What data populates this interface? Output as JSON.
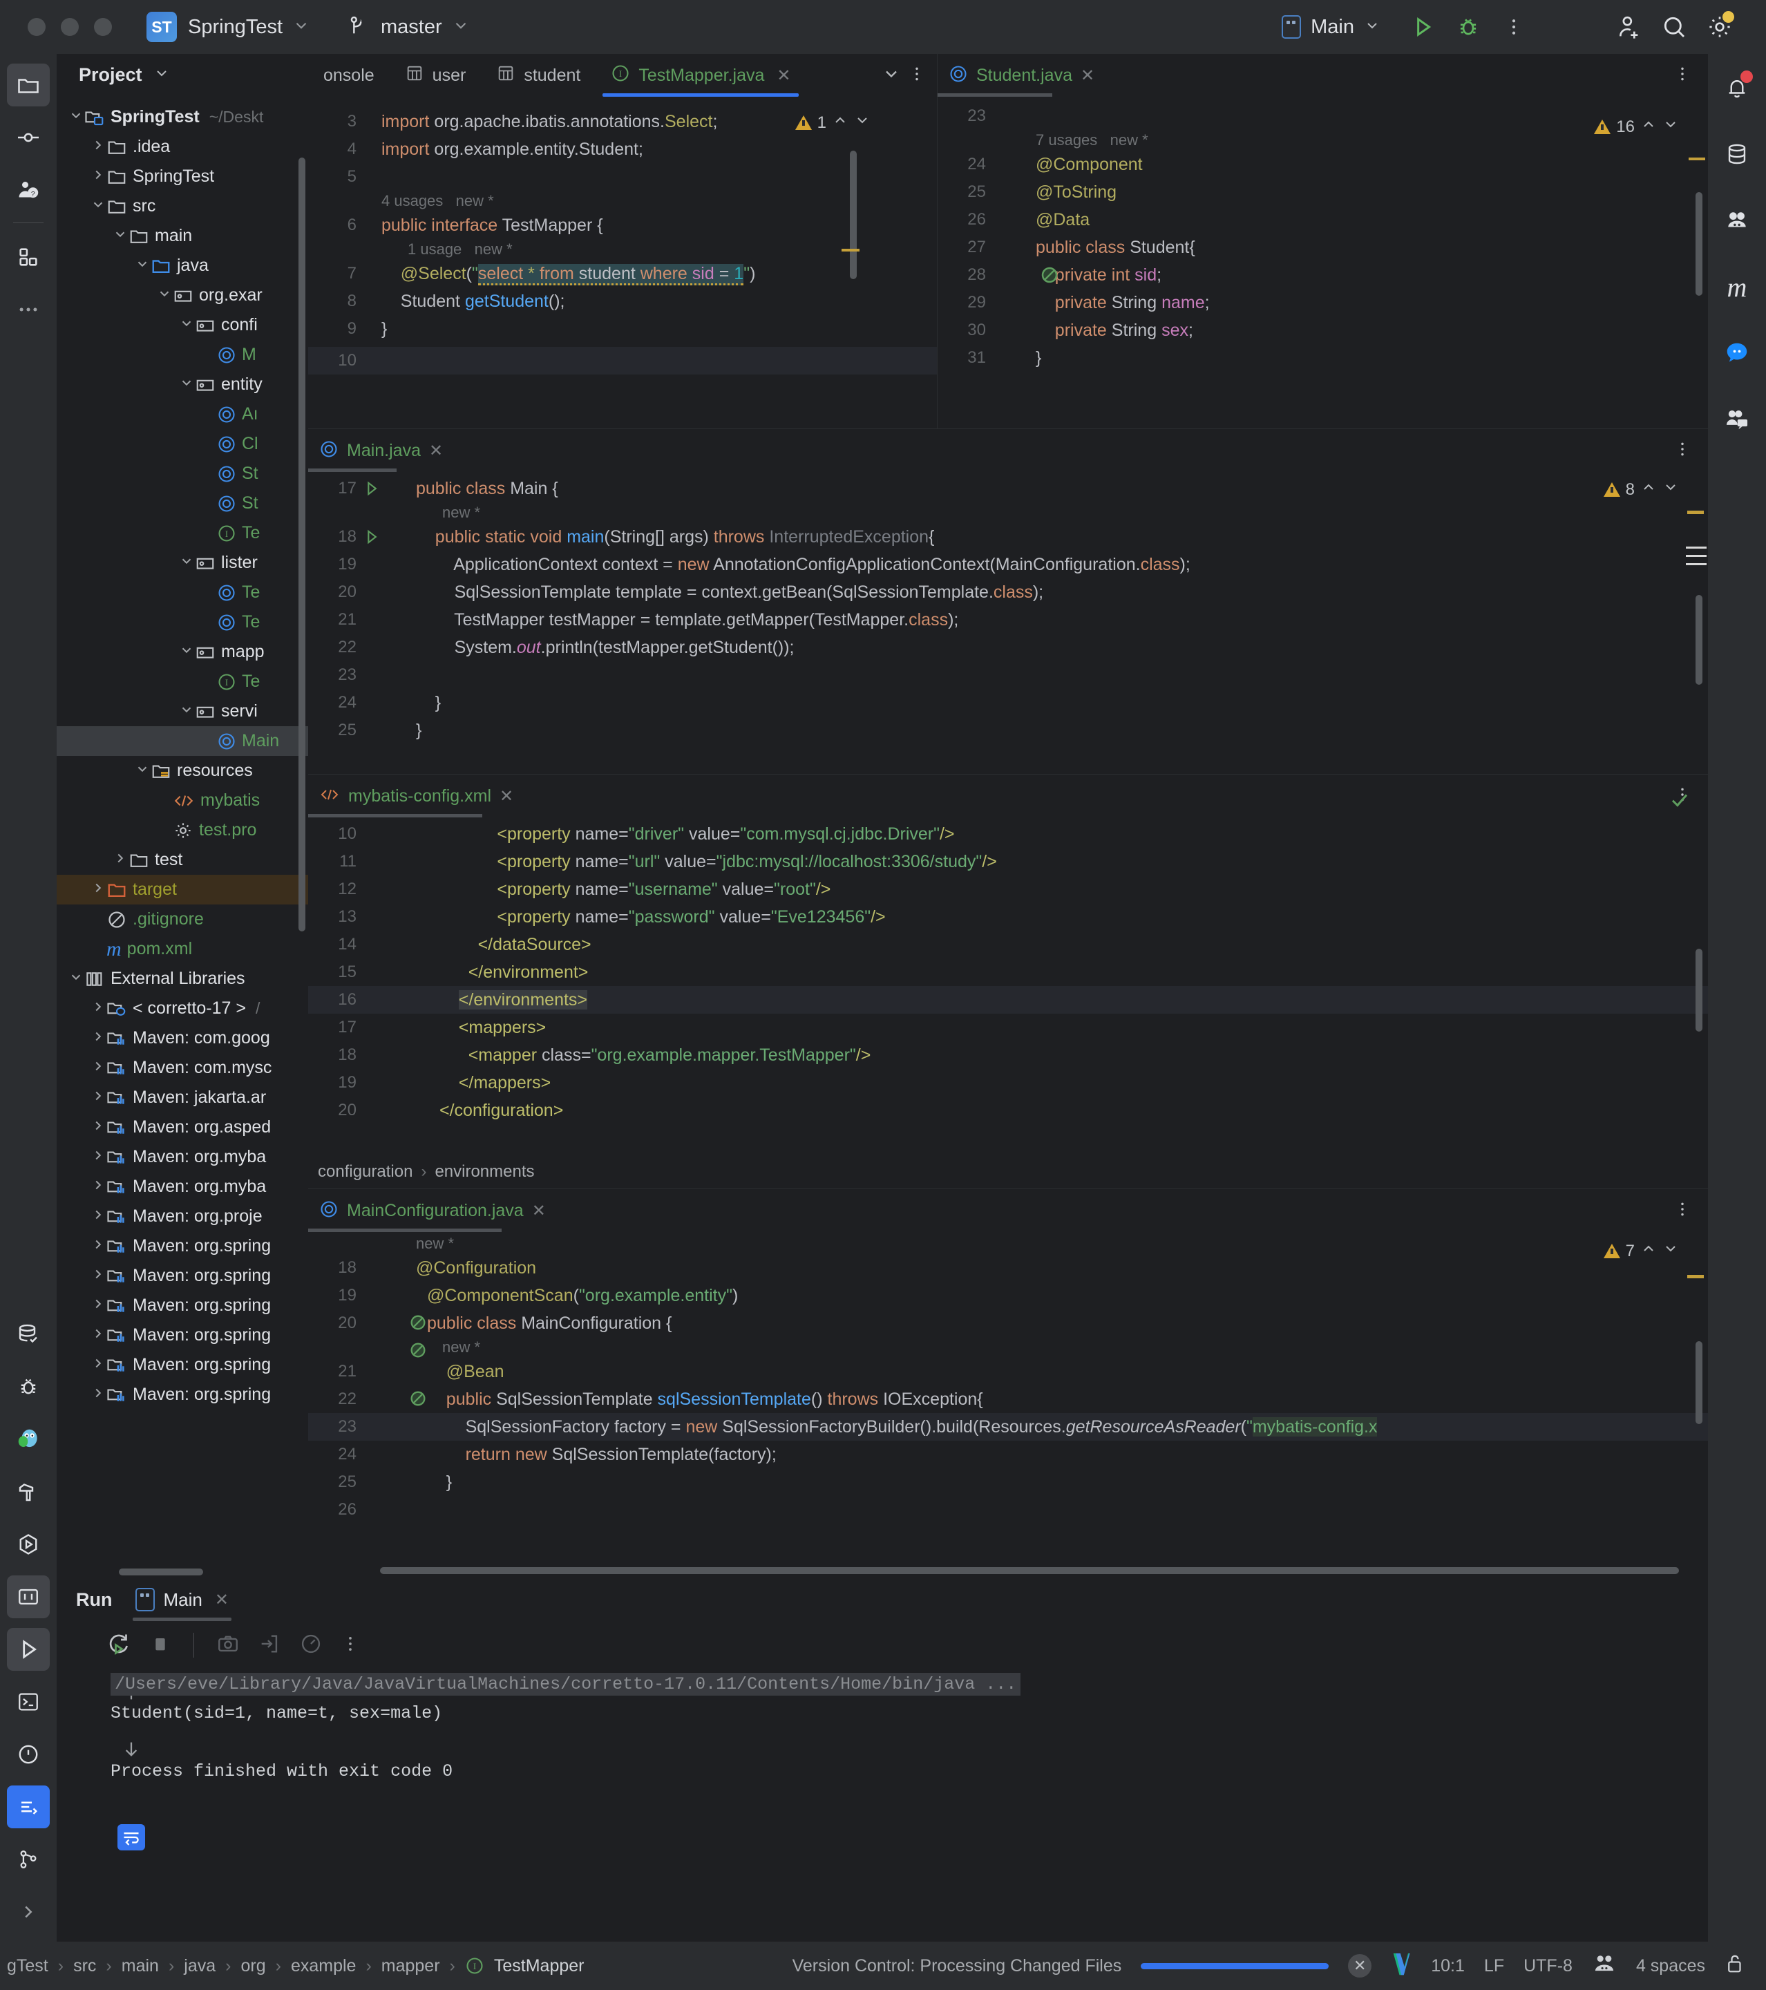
{
  "titlebar": {
    "project_badge": "ST",
    "project_name": "SpringTest",
    "branch": "master",
    "run_config": "Main",
    "icons": {
      "run": "run-icon",
      "debug": "debug-icon",
      "more": "more-vertical-icon",
      "add_user": "add-user-icon",
      "search": "search-icon",
      "settings": "gear-icon"
    }
  },
  "left_strip": {
    "items": [
      {
        "name": "project-tool-icon",
        "selected": true
      },
      {
        "name": "commit-tool-icon",
        "selected": false
      },
      {
        "name": "pull-requests-tool-icon",
        "selected": false
      },
      {
        "name": "plugins-tool-icon",
        "selected": false
      },
      {
        "name": "more-tools-icon",
        "selected": false
      }
    ],
    "bottom_items": [
      {
        "name": "database-tool-icon"
      },
      {
        "name": "debug-tool-icon"
      },
      {
        "name": "go-plugin-icon"
      },
      {
        "name": "build-tool-icon"
      },
      {
        "name": "services-tool-icon"
      },
      {
        "name": "terminal-tool-icon"
      },
      {
        "name": "problems-tool-icon"
      },
      {
        "name": "run-tool-icon",
        "selected": true
      },
      {
        "name": "terminal-alt-icon"
      },
      {
        "name": "warnings-icon"
      },
      {
        "name": "version-control-icon"
      },
      {
        "name": "expand-icon"
      }
    ]
  },
  "right_strip": {
    "items": [
      {
        "name": "notifications-bell-icon",
        "badge": true
      },
      {
        "name": "database-icon"
      },
      {
        "name": "ai-assistant-icon"
      },
      {
        "name": "maven-icon"
      },
      {
        "name": "chat-bubble-icon",
        "active": true
      },
      {
        "name": "code-with-me-icon"
      }
    ]
  },
  "project_panel": {
    "title": "Project",
    "tree": [
      {
        "depth": 0,
        "arrow": "down",
        "icon": "module-folder-icon",
        "label": "SpringTest",
        "bold": true,
        "path": "~/Deskt"
      },
      {
        "depth": 1,
        "arrow": "right",
        "icon": "folder-icon",
        "label": ".idea"
      },
      {
        "depth": 1,
        "arrow": "right",
        "icon": "folder-icon",
        "label": "SpringTest"
      },
      {
        "depth": 1,
        "arrow": "down",
        "icon": "folder-icon",
        "label": "src"
      },
      {
        "depth": 2,
        "arrow": "down",
        "icon": "folder-icon",
        "label": "main"
      },
      {
        "depth": 3,
        "arrow": "down",
        "icon": "source-folder-icon",
        "label": "java"
      },
      {
        "depth": 4,
        "arrow": "down",
        "icon": "package-icon",
        "label": "org.exar"
      },
      {
        "depth": 5,
        "arrow": "down",
        "icon": "package-icon",
        "label": "confi"
      },
      {
        "depth": 6,
        "arrow": "none",
        "icon": "class-icon",
        "label": "M",
        "color": "green"
      },
      {
        "depth": 5,
        "arrow": "down",
        "icon": "package-icon",
        "label": "entity"
      },
      {
        "depth": 6,
        "arrow": "none",
        "icon": "class-icon",
        "label": "Aı",
        "color": "green"
      },
      {
        "depth": 6,
        "arrow": "none",
        "icon": "class-icon",
        "label": "Cl",
        "color": "green"
      },
      {
        "depth": 6,
        "arrow": "none",
        "icon": "class-icon",
        "label": "St",
        "color": "green"
      },
      {
        "depth": 6,
        "arrow": "none",
        "icon": "class-icon",
        "label": "St",
        "color": "green"
      },
      {
        "depth": 6,
        "arrow": "none",
        "icon": "interface-icon",
        "label": "Te",
        "color": "green"
      },
      {
        "depth": 5,
        "arrow": "down",
        "icon": "package-icon",
        "label": "lister"
      },
      {
        "depth": 6,
        "arrow": "none",
        "icon": "class-icon",
        "label": "Te",
        "color": "green"
      },
      {
        "depth": 6,
        "arrow": "none",
        "icon": "class-icon",
        "label": "Te",
        "color": "green"
      },
      {
        "depth": 5,
        "arrow": "down",
        "icon": "package-icon",
        "label": "mapp"
      },
      {
        "depth": 6,
        "arrow": "none",
        "icon": "interface-icon",
        "label": "Te",
        "color": "green"
      },
      {
        "depth": 5,
        "arrow": "down",
        "icon": "package-icon",
        "label": "servi"
      },
      {
        "depth": 6,
        "arrow": "none",
        "icon": "class-icon",
        "label": "Main",
        "color": "green",
        "selected": true
      },
      {
        "depth": 3,
        "arrow": "down",
        "icon": "resources-folder-icon",
        "label": "resources"
      },
      {
        "depth": 4,
        "arrow": "none",
        "icon": "xml-icon",
        "label": "mybatis",
        "color": "green"
      },
      {
        "depth": 4,
        "arrow": "none",
        "icon": "properties-icon",
        "label": "test.pro",
        "color": "green"
      },
      {
        "depth": 2,
        "arrow": "right",
        "icon": "folder-icon",
        "label": "test"
      },
      {
        "depth": 1,
        "arrow": "right",
        "icon": "target-folder-icon",
        "label": "target",
        "color": "olive",
        "selected_orange": true
      },
      {
        "depth": 1,
        "arrow": "none",
        "icon": "gitignore-icon",
        "label": ".gitignore",
        "color": "green"
      },
      {
        "depth": 1,
        "arrow": "none",
        "icon": "maven-file-icon",
        "label": "pom.xml",
        "color": "green"
      },
      {
        "depth": 0,
        "arrow": "down",
        "icon": "external-libraries-icon",
        "label": "External Libraries"
      },
      {
        "depth": 1,
        "arrow": "right",
        "icon": "jdk-icon",
        "label": "< corretto-17 >",
        "path": "/ "
      },
      {
        "depth": 1,
        "arrow": "right",
        "icon": "library-icon",
        "label": "Maven: com.goog"
      },
      {
        "depth": 1,
        "arrow": "right",
        "icon": "library-icon",
        "label": "Maven: com.mysc"
      },
      {
        "depth": 1,
        "arrow": "right",
        "icon": "library-icon",
        "label": "Maven: jakarta.ar"
      },
      {
        "depth": 1,
        "arrow": "right",
        "icon": "library-icon",
        "label": "Maven: org.asped"
      },
      {
        "depth": 1,
        "arrow": "right",
        "icon": "library-icon",
        "label": "Maven: org.myba"
      },
      {
        "depth": 1,
        "arrow": "right",
        "icon": "library-icon",
        "label": "Maven: org.myba"
      },
      {
        "depth": 1,
        "arrow": "right",
        "icon": "library-icon",
        "label": "Maven: org.proje"
      },
      {
        "depth": 1,
        "arrow": "right",
        "icon": "library-icon",
        "label": "Maven: org.spring"
      },
      {
        "depth": 1,
        "arrow": "right",
        "icon": "library-icon",
        "label": "Maven: org.spring"
      },
      {
        "depth": 1,
        "arrow": "right",
        "icon": "library-icon",
        "label": "Maven: org.spring"
      },
      {
        "depth": 1,
        "arrow": "right",
        "icon": "library-icon",
        "label": "Maven: org.spring"
      },
      {
        "depth": 1,
        "arrow": "right",
        "icon": "library-icon",
        "label": "Maven: org.spring"
      },
      {
        "depth": 1,
        "arrow": "right",
        "icon": "library-icon",
        "label": "Maven: org.spring"
      }
    ]
  },
  "editor_tabs": [
    {
      "label": "onsole",
      "icon": "none",
      "active": false,
      "closable": false
    },
    {
      "label": "user",
      "icon": "table-icon",
      "active": false,
      "closable": false
    },
    {
      "label": "student",
      "icon": "table-icon",
      "active": false,
      "closable": false
    },
    {
      "label": "TestMapper.java",
      "icon": "interface-icon",
      "active": true,
      "closable": true
    }
  ],
  "panes": {
    "testmapper": {
      "tab_label": "TestMapper.java",
      "warning_count": "1",
      "lines": [
        {
          "no": "3",
          "kind": "code"
        },
        {
          "no": "4",
          "kind": "code"
        },
        {
          "no": "5",
          "kind": "code"
        },
        {
          "no": "",
          "kind": "hint",
          "text": "4 usages   new *"
        },
        {
          "no": "6",
          "kind": "code"
        },
        {
          "no": "",
          "kind": "hint",
          "text": "1 usage   new *"
        },
        {
          "no": "7",
          "kind": "code"
        },
        {
          "no": "8",
          "kind": "code"
        },
        {
          "no": "9",
          "kind": "code"
        },
        {
          "no": "10",
          "kind": "code"
        }
      ],
      "sql_literal": "select * from student where sid = 1"
    },
    "student": {
      "tab_label": "Student.java",
      "warning_count": "16",
      "usages_hint": "7 usages   new *",
      "line_numbers": [
        "23",
        "24",
        "25",
        "26",
        "27",
        "28",
        "29",
        "30",
        "31"
      ],
      "code": [
        "",
        "@Component",
        "@ToString",
        "@Data",
        "public class Student{",
        "    private int sid;",
        "    private String name;",
        "    private String sex;",
        "}"
      ]
    },
    "main": {
      "tab_label": "Main.java",
      "warning_count": "8",
      "line_numbers": [
        "17",
        "18",
        "19",
        "20",
        "21",
        "22",
        "23",
        "24",
        "25"
      ],
      "hint_new": "new *"
    },
    "mybatis": {
      "tab_label": "mybatis-config.xml",
      "line_numbers": [
        "10",
        "11",
        "12",
        "13",
        "14",
        "15",
        "16",
        "17",
        "18",
        "19",
        "20"
      ],
      "properties": [
        {
          "name": "driver",
          "value": "com.mysql.cj.jdbc.Driver"
        },
        {
          "name": "url",
          "value": "jdbc:mysql://localhost:3306/study"
        },
        {
          "name": "username",
          "value": "root"
        },
        {
          "name": "password",
          "value": "Eve123456"
        }
      ],
      "mapper_class": "org.example.mapper.TestMapper",
      "breadcrumbs": [
        "configuration",
        "environments"
      ],
      "status_ok": "check-icon"
    },
    "mainconfig": {
      "tab_label": "MainConfiguration.java",
      "warning_count": "7",
      "hint_new": "new *",
      "line_numbers": [
        "18",
        "19",
        "20",
        "21",
        "22",
        "23",
        "24",
        "25",
        "26"
      ],
      "component_scan": "org.example.entity",
      "resource_name": "mybatis-config.x"
    }
  },
  "run_panel": {
    "title": "Run",
    "tab_label": "Main",
    "toolbar_icons": [
      "rerun-icon",
      "stop-icon",
      "camera-icon",
      "export-icon",
      "profiler-icon",
      "more-vertical-icon"
    ],
    "gutter_icons": [
      "scroll-up-icon",
      "scroll-down-icon",
      "soft-wrap-icon"
    ],
    "console_lines": [
      {
        "text": "/Users/eve/Library/Java/JavaVirtualMachines/corretto-17.0.11/Contents/Home/bin/java ...",
        "style": "path"
      },
      {
        "text": "Student(sid=1, name=t, sex=male)",
        "style": "normal"
      },
      {
        "text": "",
        "style": "normal"
      },
      {
        "text": "Process finished with exit code 0",
        "style": "normal"
      }
    ]
  },
  "status_bar": {
    "breadcrumbs": [
      "gTest",
      "src",
      "main",
      "java",
      "org",
      "example",
      "mapper",
      "TestMapper"
    ],
    "vcs_status": "Version Control: Processing Changed Files",
    "caret_position": "10:1",
    "line_separator": "LF",
    "encoding": "UTF-8",
    "indent": "4 spaces",
    "icons": [
      "close-progress-icon",
      "vim-icon",
      "ai-icon",
      "lock-icon"
    ]
  },
  "colors": {
    "accent": "#3574f0",
    "warning": "#d6a531",
    "success": "#5f9e5f",
    "bg": "#1e1f22",
    "panel": "#2b2d30"
  }
}
